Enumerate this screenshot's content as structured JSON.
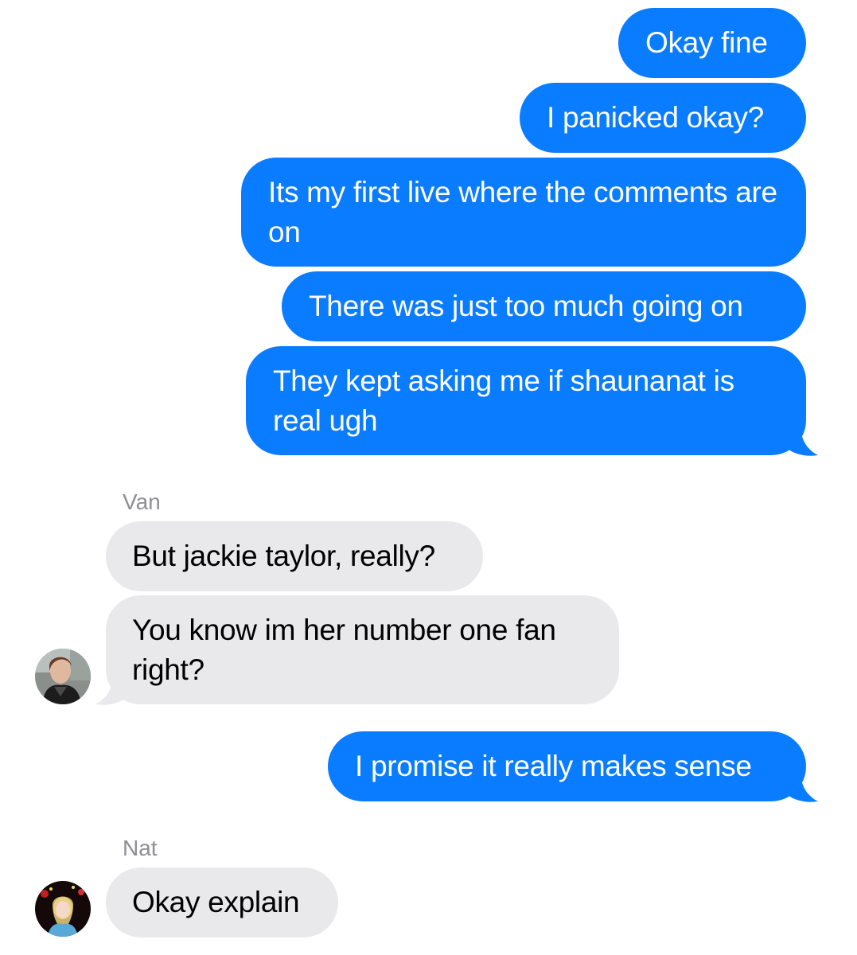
{
  "conversation": {
    "messages": [
      {
        "direction": "outgoing",
        "text": "Okay fine"
      },
      {
        "direction": "outgoing",
        "text": "I panicked okay?"
      },
      {
        "direction": "outgoing",
        "text": "Its my first live where the comments are on"
      },
      {
        "direction": "outgoing",
        "text": "There was just too much going on"
      },
      {
        "direction": "outgoing",
        "text": "They kept asking me if shaunanat is real ugh"
      },
      {
        "direction": "incoming",
        "sender": "Van",
        "text": "But jackie taylor, really?"
      },
      {
        "direction": "incoming",
        "sender": "Van",
        "text": "You know im her number one fan right?"
      },
      {
        "direction": "outgoing",
        "text": "I promise it really makes sense"
      },
      {
        "direction": "incoming",
        "sender": "Nat",
        "text": "Okay explain"
      }
    ],
    "senders": {
      "van": "Van",
      "nat": "Nat"
    }
  },
  "colors": {
    "outgoing_bubble": "#0a7cff",
    "incoming_bubble": "#e9e9eb",
    "sender_label": "#8e8e93"
  },
  "icons": {
    "van_avatar": "van-avatar-photo",
    "nat_avatar": "nat-avatar-photo"
  }
}
